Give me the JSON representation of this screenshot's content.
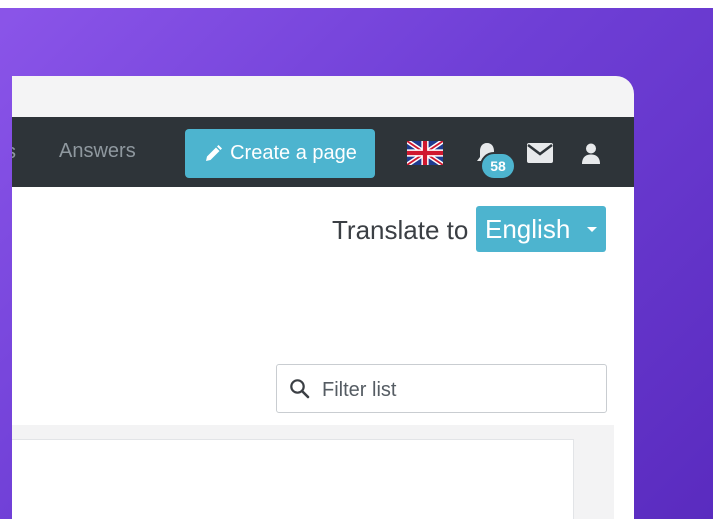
{
  "navbar": {
    "partial_item": "s",
    "answers_label": "Answers",
    "create_page_label": "Create a page",
    "notification_count": "58"
  },
  "translate": {
    "label": "Translate to",
    "language": "English"
  },
  "filter": {
    "placeholder": "Filter list"
  },
  "icons": {
    "create": "pencil-icon",
    "language": "uk-flag-icon",
    "notifications": "bell-icon",
    "messages": "mail-icon",
    "account": "user-icon",
    "filter": "search-icon"
  },
  "colors": {
    "background_gradient_start": "#8b55e9",
    "background_gradient_end": "#5a2bbf",
    "navbar": "#2e3439",
    "accent": "#4db4cf",
    "nav_text": "#8f989f",
    "content_text": "#3b3f44"
  }
}
